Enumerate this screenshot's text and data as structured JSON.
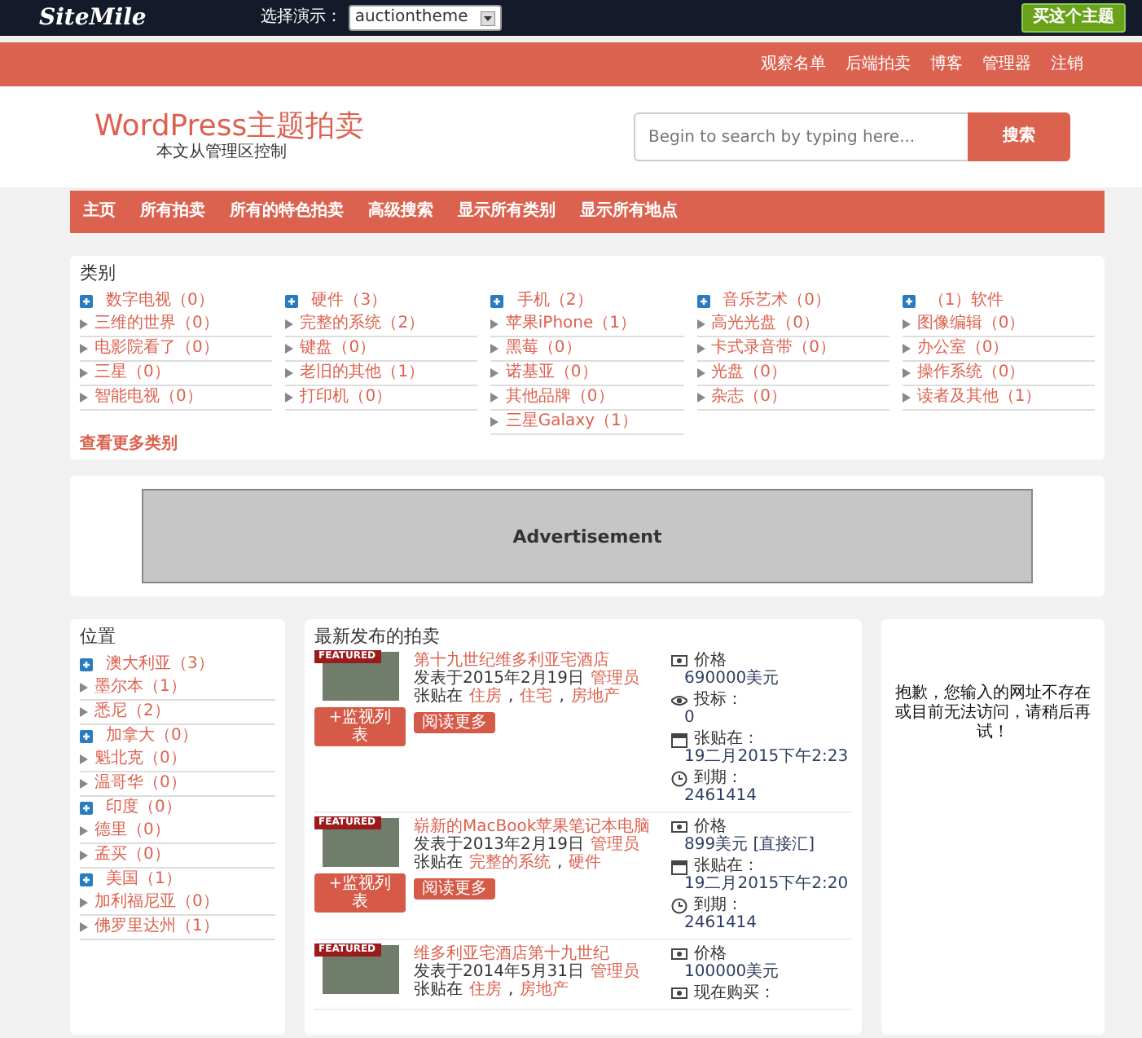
{
  "topbar": {
    "logo": "SiteMile",
    "demo_label": "选择演示：",
    "demo_select": "auctiontheme",
    "buy_button": "买这个主题"
  },
  "user_links": [
    "观察名单",
    "后端拍卖",
    "博客",
    "管理器",
    "注销"
  ],
  "header": {
    "site_title": "WordPress主题拍卖",
    "tagline": "本文从管理区控制",
    "search": {
      "placeholder": "Begin to search by typing here...",
      "button": "搜索"
    }
  },
  "nav": [
    "主页",
    "所有拍卖",
    "所有的特色拍卖",
    "高级搜索",
    "显示所有类别",
    "显示所有地点"
  ],
  "categories": {
    "title": "类别",
    "columns": [
      {
        "name": "数字电视（0）",
        "children": [
          "三维的世界（0）",
          "电影院看了（0）",
          "三星（0）",
          "智能电视（0）"
        ]
      },
      {
        "name": "硬件（3）",
        "children": [
          "完整的系统（2）",
          "键盘（0）",
          "老旧的其他（1）",
          "打印机（0）"
        ]
      },
      {
        "name": "手机（2）",
        "children": [
          "苹果iPhone（1）",
          "黑莓（0）",
          "诺基亚（0）",
          "其他品牌（0）",
          "三星Galaxy（1）"
        ]
      },
      {
        "name": "音乐艺术（0）",
        "children": [
          "高光光盘（0）",
          "卡式录音带（0）",
          "光盘（0）",
          "杂志（0）"
        ]
      },
      {
        "name": "（1）软件",
        "children": [
          "图像编辑（0）",
          "办公室（0）",
          "操作系统（0）",
          "读者及其他（1）"
        ]
      }
    ],
    "more_link": "查看更多类别"
  },
  "ad": {
    "label": "Advertisement"
  },
  "locations": {
    "title": "位置",
    "items": [
      {
        "name": "澳大利亚（3）",
        "children": [
          "墨尔本（1）",
          "悉尼（2）"
        ]
      },
      {
        "name": "加拿大（0）",
        "children": [
          "魁北克（0）",
          "温哥华（0）"
        ]
      },
      {
        "name": "印度（0）",
        "children": [
          "德里（0）",
          "孟买（0）"
        ]
      },
      {
        "name": "美国（1）",
        "children": [
          "加利福尼亚（0）",
          "佛罗里达州（1）"
        ]
      }
    ]
  },
  "latest": {
    "title": "最新发布的拍卖",
    "tag_separator": ",",
    "listings": [
      {
        "badge": "FEATURED",
        "title": "第十九世纪维多利亚宅酒店",
        "posted": "发表于2015年2月19日",
        "author": "管理员",
        "tags_label": "张贴在",
        "tags": [
          "住房",
          "住宅",
          "房地产"
        ],
        "watch_button": "+监视列表",
        "read_more": "阅读更多",
        "meta": [
          {
            "kind": "price",
            "label": "价格",
            "value": "690000美元"
          },
          {
            "kind": "bids",
            "label": "投标：",
            "value": "0"
          },
          {
            "kind": "posted",
            "label": "张贴在：",
            "value": "19二月2015下午2:23"
          },
          {
            "kind": "expires",
            "label": "到期：",
            "value": "2461414"
          }
        ]
      },
      {
        "badge": "FEATURED",
        "title": "崭新的MacBook苹果笔记本电脑",
        "posted": "发表于2013年2月19日",
        "author": "管理员",
        "tags_label": "张贴在",
        "tags": [
          "完整的系统",
          "硬件"
        ],
        "watch_button": "+监视列表",
        "read_more": "阅读更多",
        "meta": [
          {
            "kind": "price",
            "label": "价格",
            "value": "899美元 [直接汇]"
          },
          {
            "kind": "posted",
            "label": "张贴在：",
            "value": "19二月2015下午2:20"
          },
          {
            "kind": "expires",
            "label": "到期：",
            "value": "2461414"
          }
        ]
      },
      {
        "badge": "FEATURED",
        "title": "维多利亚宅酒店第十九世纪",
        "posted": "发表于2014年5月31日",
        "author": "管理员",
        "tags_label": "张贴在",
        "tags": [
          "住房",
          "房地产"
        ],
        "meta": [
          {
            "kind": "price",
            "label": "价格",
            "value": "100000美元"
          },
          {
            "kind": "price",
            "label": "现在购买："
          }
        ]
      }
    ]
  },
  "notice": {
    "text": "抱歉，您输入的网址不存在或目前无法访问，请稍后再试！"
  }
}
